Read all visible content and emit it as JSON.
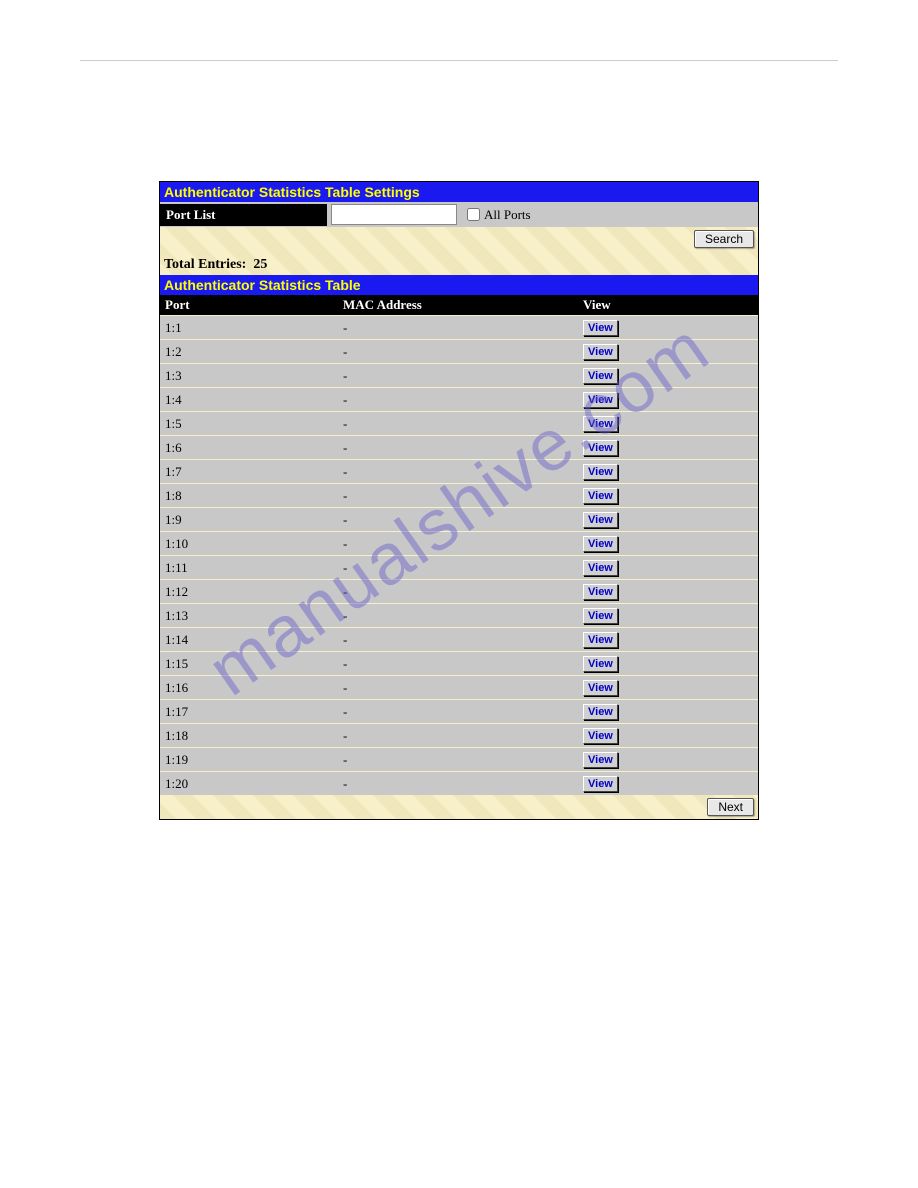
{
  "watermark_text": "manualshive.com",
  "settings": {
    "title": "Authenticator Statistics Table Settings",
    "port_list_label": "Port List",
    "port_list_value": "",
    "all_ports_label": "All Ports",
    "all_ports_checked": false,
    "search_button": "Search"
  },
  "summary": {
    "total_entries_label": "Total Entries:",
    "total_entries_value": "25"
  },
  "table": {
    "title": "Authenticator Statistics Table",
    "columns": {
      "port": "Port",
      "mac": "MAC Address",
      "view": "View"
    },
    "view_button_label": "View",
    "rows": [
      {
        "port": "1:1",
        "mac": "-"
      },
      {
        "port": "1:2",
        "mac": "-"
      },
      {
        "port": "1:3",
        "mac": "-"
      },
      {
        "port": "1:4",
        "mac": "-"
      },
      {
        "port": "1:5",
        "mac": "-"
      },
      {
        "port": "1:6",
        "mac": "-"
      },
      {
        "port": "1:7",
        "mac": "-"
      },
      {
        "port": "1:8",
        "mac": "-"
      },
      {
        "port": "1:9",
        "mac": "-"
      },
      {
        "port": "1:10",
        "mac": "-"
      },
      {
        "port": "1:11",
        "mac": "-"
      },
      {
        "port": "1:12",
        "mac": "-"
      },
      {
        "port": "1:13",
        "mac": "-"
      },
      {
        "port": "1:14",
        "mac": "-"
      },
      {
        "port": "1:15",
        "mac": "-"
      },
      {
        "port": "1:16",
        "mac": "-"
      },
      {
        "port": "1:17",
        "mac": "-"
      },
      {
        "port": "1:18",
        "mac": "-"
      },
      {
        "port": "1:19",
        "mac": "-"
      },
      {
        "port": "1:20",
        "mac": "-"
      }
    ]
  },
  "footer": {
    "next_button": "Next"
  }
}
